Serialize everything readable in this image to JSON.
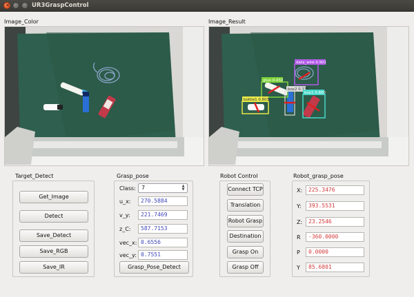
{
  "window": {
    "title": "UR3GraspControl"
  },
  "images": {
    "color_label": "Image_Color",
    "result_label": "Image_Result",
    "detections": [
      {
        "label": "data_wire 0.901",
        "color": "#b25be8"
      },
      {
        "label": "glue 0.432",
        "color": "#7fd23a"
      },
      {
        "label": "box2 0.739",
        "color": "#dcdcdc"
      },
      {
        "label": "bottle1 0.803",
        "color": "#e8e84a"
      },
      {
        "label": "box1 0.860",
        "color": "#4ad7c9"
      }
    ]
  },
  "target_detect": {
    "title": "Target_Detect",
    "buttons": [
      "Get_Image",
      "Detect",
      "Save_Detect",
      "Save_RGB",
      "Save_IR"
    ]
  },
  "grasp_pose": {
    "title": "Grasp_pose",
    "class_label": "Class:",
    "class_value": "7",
    "fields": [
      {
        "label": "u_x:",
        "value": "270.5884"
      },
      {
        "label": "v_y:",
        "value": "221.7469"
      },
      {
        "label": "z_C:",
        "value": "587.7153"
      },
      {
        "label": "vec_x:",
        "value": "0.6556"
      },
      {
        "label": "vec_y:",
        "value": "0.7551"
      }
    ],
    "detect_button": "Grasp_Pose_Detect"
  },
  "robot_control": {
    "title": "Robot Control",
    "buttons": [
      "Connect TCP",
      "Translation",
      "Robot Grasp",
      "Destination",
      "Grasp On",
      "Grasp Off"
    ]
  },
  "robot_grasp_pose": {
    "title": "Robot_grasp_pose",
    "fields": [
      {
        "label": "X:",
        "value": "225.3476"
      },
      {
        "label": "Y:",
        "value": "393.5531"
      },
      {
        "label": "Z:",
        "value": "23.2546"
      },
      {
        "label": "R",
        "value": "-360.0000"
      },
      {
        "label": "P",
        "value": "0.0000"
      },
      {
        "label": "Y",
        "value": "85.6801"
      }
    ]
  }
}
